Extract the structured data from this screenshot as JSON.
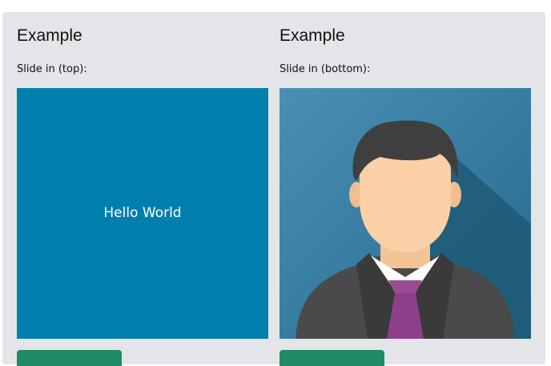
{
  "examples": [
    {
      "heading": "Example",
      "label": "Slide in (top):",
      "overlay_text": "Hello World",
      "box_color": "#007fae"
    },
    {
      "heading": "Example",
      "label": "Slide in (bottom):",
      "image": "avatar-businessman"
    }
  ],
  "colors": {
    "panel_bg": "#e3e5e8",
    "button": "#1f8a63"
  }
}
